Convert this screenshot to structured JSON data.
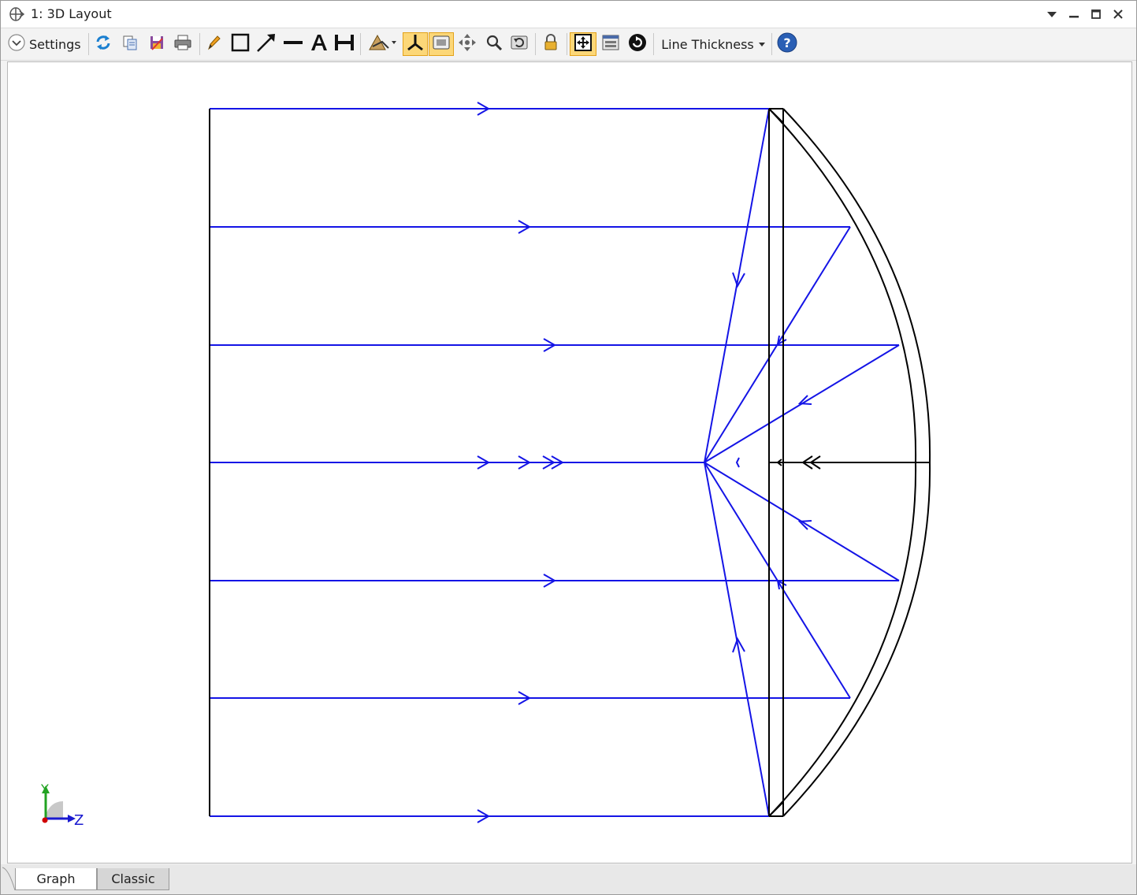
{
  "window": {
    "title": "1: 3D Layout",
    "controls": [
      "dropdown",
      "minimize",
      "maximize",
      "close"
    ]
  },
  "toolbar": {
    "settings_label": "Settings",
    "line_thickness_label": "Line Thickness",
    "icons": [
      "refresh-icon",
      "copy-icon",
      "save-icon",
      "print-icon",
      "pencil-icon",
      "rectangle-icon",
      "arrow-icon",
      "line-icon",
      "text-icon",
      "dimension-icon",
      "rotate-view-icon",
      "axes-icon",
      "snap-icon",
      "pan-icon",
      "zoom-icon",
      "undo-zoom-icon",
      "lock-icon",
      "fit-window-icon",
      "layout-icon",
      "cycle-icon",
      "help-icon"
    ]
  },
  "axis_triad": {
    "y_label": "Y",
    "z_label": "Z"
  },
  "tabs": [
    {
      "label": "Graph",
      "active": true
    },
    {
      "label": "Classic",
      "active": false
    }
  ],
  "colors": {
    "ray": "#1414e6",
    "element": "#000000",
    "active_button": "#fcd778",
    "triad_y": "#22a322",
    "triad_z": "#1a1ad0",
    "triad_origin": "#d00000"
  }
}
